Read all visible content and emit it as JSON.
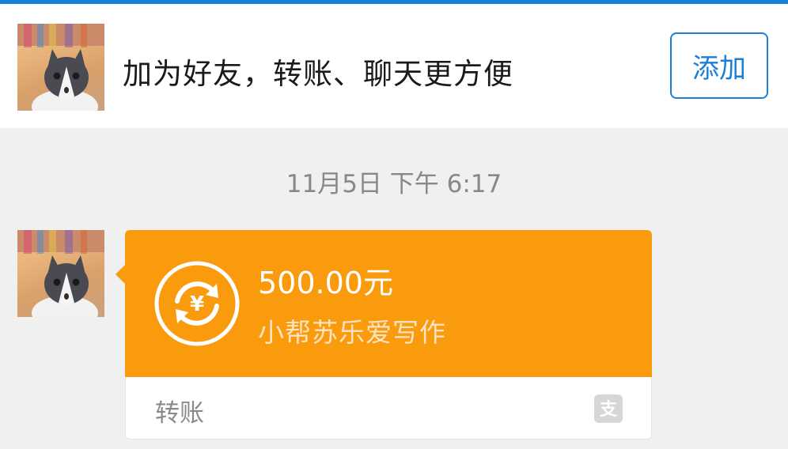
{
  "header": {
    "avatar_icon": "cat-avatar-icon",
    "prompt": "加为好友，转账、聊天更方便",
    "add_label": "添加"
  },
  "chat": {
    "timestamp": "11月5日 下午 6:17",
    "message": {
      "sender_avatar": "cat-avatar-icon",
      "amount": "500.00元",
      "payee": "小帮苏乐爱写作",
      "type_label": "转账",
      "transfer_icon": "yuan-transfer-icon",
      "brand_icon": "alipay-icon",
      "card_color": "#fa9a0d"
    }
  },
  "colors": {
    "accent": "#1a7fd6",
    "background": "#f0f0f0"
  }
}
